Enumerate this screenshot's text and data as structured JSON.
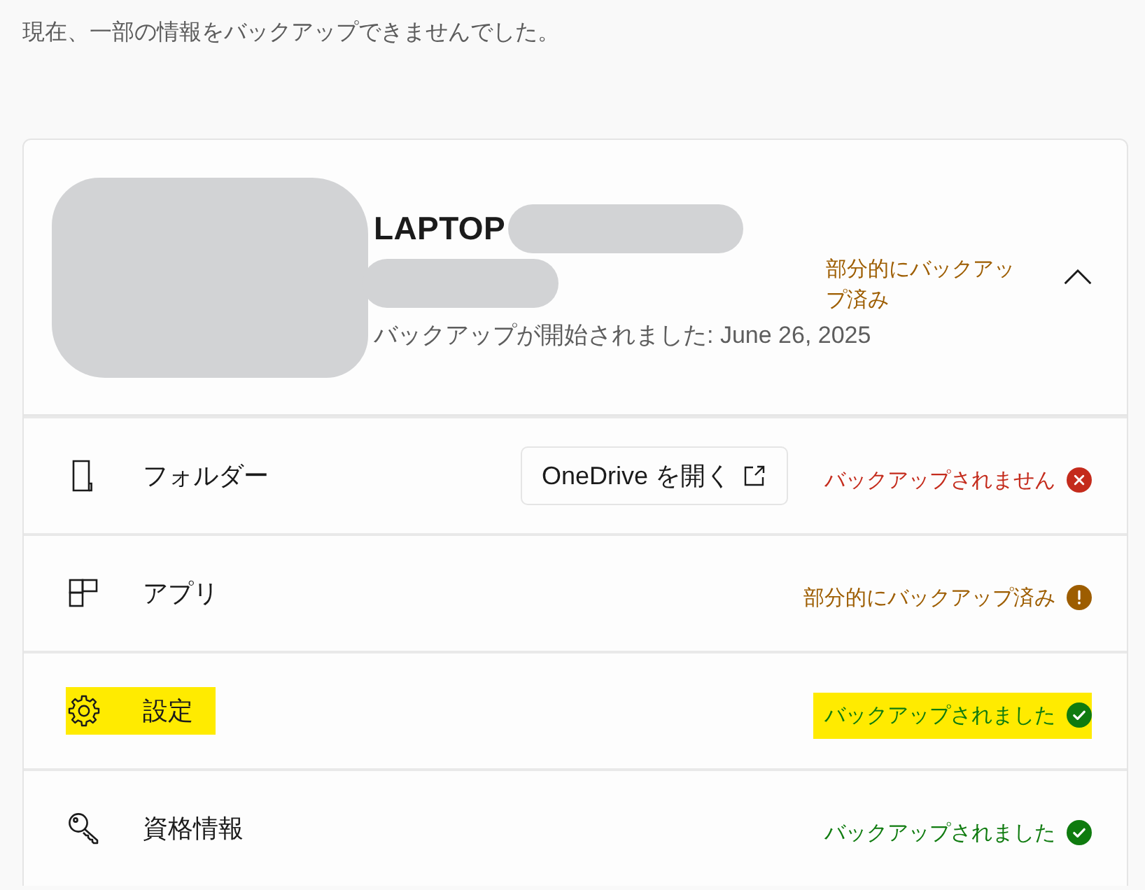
{
  "intro": "現在、一部の情報をバックアップできませんでした。",
  "device": {
    "name": "LAPTOP",
    "redacted": true,
    "status": {
      "kind": "partial",
      "text": "部分的にバックアップ済み"
    },
    "started": "バックアップが開始されました: June 26, 2025",
    "expanded": true
  },
  "items": [
    {
      "kind": "folder",
      "label": "フォルダー",
      "button": "OneDrive を開く",
      "status": {
        "kind": "error",
        "text": "バックアップされません"
      },
      "highlighted": false
    },
    {
      "kind": "apps",
      "label": "アプリ",
      "status": {
        "kind": "partial",
        "text": "部分的にバックアップ済み"
      },
      "highlighted": false
    },
    {
      "kind": "settings",
      "label": "設定",
      "status": {
        "kind": "success",
        "text": "バックアップされました"
      },
      "highlighted": true
    },
    {
      "kind": "credentials",
      "label": "資格情報",
      "status": {
        "kind": "success",
        "text": "バックアップされました"
      },
      "highlighted": false
    }
  ]
}
